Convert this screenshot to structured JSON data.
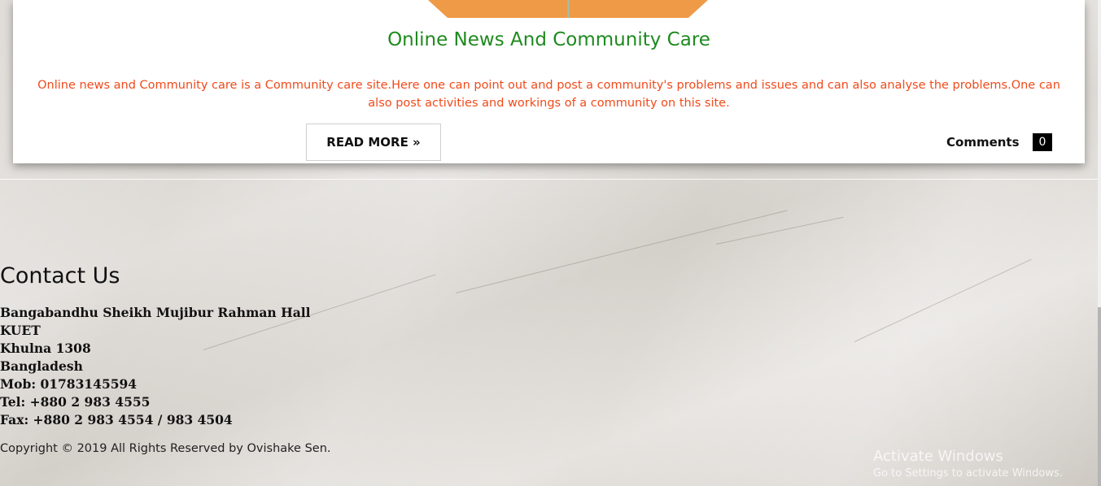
{
  "post": {
    "title": "Online News And Community Care",
    "body": "Online news and Community care is a Community care site.Here one can point out and post a community's problems and issues and can also analyse the problems.One can also post activities and workings of a community on this site.",
    "read_more_label": "READ MORE »",
    "comments_label": "Comments",
    "comments_count": "0",
    "image_color": "#ef9a47"
  },
  "footer": {
    "contact_title": "Contact Us",
    "address_lines": [
      "Bangabandhu Sheikh Mujibur Rahman Hall",
      "KUET",
      "Khulna 1308",
      "Bangladesh",
      "Mob: 01783145594",
      "Tel: +880 2 983 4555",
      "Fax: +880 2 983 4554 / 983 4504"
    ],
    "copyright": "Copyright © 2019 All Rights Reserved by Ovishake Sen."
  },
  "watermark": {
    "title": "Activate Windows",
    "subtitle": "Go to Settings to activate Windows."
  },
  "colors": {
    "title_green": "#1e8a1e",
    "body_orange_red": "#f04a1a",
    "badge_black": "#000000"
  }
}
